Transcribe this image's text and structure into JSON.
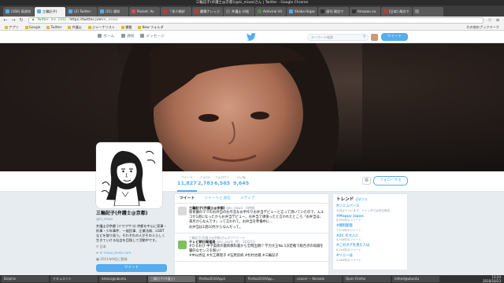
{
  "window": {
    "title": "三輪記子(弁護士@京都)(@ki_miwa)さん | Twitter - Google Chrome"
  },
  "tabs": [
    {
      "label": "(166) 高須克",
      "color": "#55acee"
    },
    {
      "label": "三輪記子(",
      "color": "#55acee",
      "active": true
    },
    {
      "label": "(2) Twitter",
      "color": "#55acee"
    },
    {
      "label": "(21) 通知",
      "color": "#55acee"
    },
    {
      "label": "Pocket: Av",
      "color": "#ee4056"
    },
    {
      "label": "「多少格好",
      "color": "#cc3333"
    },
    {
      "label": "慶應ナレッジ",
      "color": "#cc3333"
    },
    {
      "label": "弁護士 村松",
      "color": "#777777"
    },
    {
      "label": "Antiviral Vir",
      "color": "#4a8a4a"
    },
    {
      "label": "Shaka Higas",
      "color": "#55acee"
    },
    {
      "label": "週刊 政治で",
      "color": "#333333"
    },
    {
      "label": "Amazon.co.",
      "color": "#333333"
    },
    {
      "label": "[日本] 政治で",
      "color": "#cc3333"
    },
    {
      "label": "",
      "color": "#888888"
    }
  ],
  "toolbar": {
    "back": "←",
    "forward": "→",
    "reload": "↻",
    "url_prefix": "Twitter, Inc. [US]",
    "url_scheme": "https://",
    "url_host": "twitter.com",
    "url_path": "/ki_miwa",
    "star": "☆"
  },
  "bookmarks": [
    "アプリ",
    "Google",
    "Twitter",
    "弁護士",
    "ジャーナリスト",
    "書籍",
    "New フォルダ"
  ],
  "bookmarks_other": "その他のブックマーク",
  "twnav": {
    "home": "ホーム",
    "notifications": "通知",
    "messages": "メッセージ",
    "search_placeholder": "キーワード検索",
    "tweet": "ツイート"
  },
  "profile": {
    "name": "三輪記子(弁護士@京都)",
    "handle": "@ki_miwa",
    "bio": "弁護士＠京都 (ミワフサコ) 京都を中心に家事・刑事・少年事件、一般民事、企業法務、LGBT などを取り扱う。それぞれの人がその人らしく生きていける社会を目指して活動中です。",
    "location": "日本",
    "website": "ki-miwa.jimdo.com",
    "joined": "2011年9月に登録",
    "tweet_button": "ツイート"
  },
  "stats": [
    {
      "label": "ツイート",
      "value": "11,827",
      "active": true
    },
    {
      "label": "フォロー",
      "value": "2,783"
    },
    {
      "label": "フォロワー",
      "value": "6,565"
    },
    {
      "label": "いいね",
      "value": "9,645"
    }
  ],
  "follow_button": "フォローする",
  "gear": "⚙",
  "timeline_tabs": [
    "ツイート",
    "ツイートと返信",
    "メディア"
  ],
  "tweets": [
    {
      "context": "",
      "name": "三輪記子(弁護士@京都)",
      "meta": "@ki_miwa · 4時間",
      "text": "保育園のママのお弁当のお丹念なお手作りお弁当デビューと言って頂いていたので、ムエコが1週になったからお弁当デビュー。お弁当で頑張ったと言われたところ「お弁当は、来月からなんです」って言われて。お弁当を準備中に…",
      "tail": "お弁当は1週10月からなんだって。",
      "avatar": "#d9d9d9"
    },
    {
      "context": "三輪記子(弁護士@京都)さんがリツイート",
      "name": "テレビ朝日報道局",
      "meta": "@tv_asahi_PR · 10月5日",
      "text": "#ひるおび 中学美術の最新教科書から全問出題!? 学力大王No.1決定戦で総合点の知識を量的なセンスを競い！",
      "tail": "#中山秀征 #大江麻理子 #石原良純 #杉村太蔵 #三輪記子",
      "avatar": "#7fbf5f"
    }
  ],
  "trends": {
    "header": "トレンド",
    "change": "変更する",
    "items": [
      {
        "name": "#ソニュバース",
        "desc": "今日はてついます。ツイッタでは本日放送…"
      },
      {
        "name": "#Mappy Japan",
        "desc": "6,500件のツイート"
      },
      {
        "name": "#無料配信",
        "desc": "7,523件のツイート"
      },
      {
        "name": "#ZC を大人に",
        "desc": "4,918件のツイート"
      },
      {
        "name": "#このタグを見た人は",
        "desc": "6,204件のツイート"
      },
      {
        "name": "#ソニーは",
        "desc": "2,000件のツイート"
      }
    ]
  },
  "taskbar": {
    "items": [
      "Dolphin",
      "ドキュメント",
      "emacs@ubuntu",
      "三輪記子(弁護士)",
      "firefox2016Appli",
      "firefox2016App...",
      "cancel — Konsole",
      "Open Firefox",
      "mfeed@ubuntu"
    ],
    "clock_time": "13:24",
    "clock_date": "2016/10/23"
  }
}
